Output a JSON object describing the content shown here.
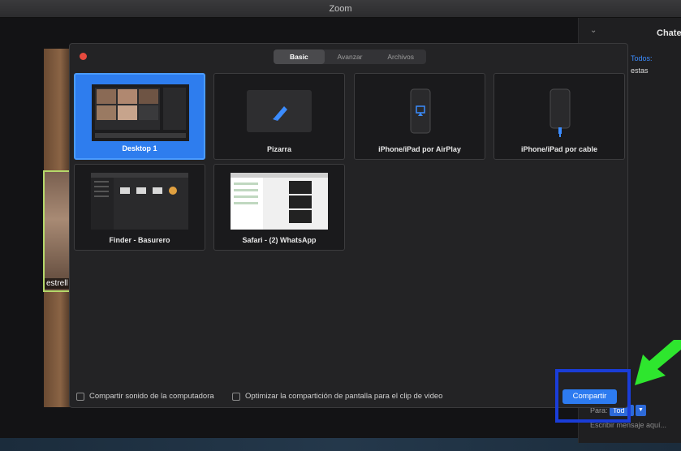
{
  "window": {
    "title": "Zoom"
  },
  "chat": {
    "title": "Chatea",
    "to_all": "Todos:",
    "message": "estas",
    "para_label": "Para:",
    "recipient": "Tod",
    "input_placeholder": "Escribir mensaje aquí..."
  },
  "participant": {
    "name": "estrell"
  },
  "dialog": {
    "tabs": [
      {
        "label": "Basic",
        "active": true
      },
      {
        "label": "Avanzar",
        "active": false
      },
      {
        "label": "Archivos",
        "active": false
      }
    ],
    "tiles": [
      {
        "label": "Desktop 1",
        "icon": "desktop-thumbnail",
        "selected": true
      },
      {
        "label": "Pizarra",
        "icon": "whiteboard-pencil-icon",
        "selected": false
      },
      {
        "label": "iPhone/iPad por AirPlay",
        "icon": "airplay-phone-icon",
        "selected": false
      },
      {
        "label": "iPhone/iPad por cable",
        "icon": "cable-phone-icon",
        "selected": false
      },
      {
        "label": "Finder - Basurero",
        "icon": "finder-window-thumbnail",
        "selected": false
      },
      {
        "label": "Safari - (2) WhatsApp",
        "icon": "safari-window-thumbnail",
        "selected": false
      }
    ],
    "options": {
      "share_sound": "Compartir sonido de la computadora",
      "optimize_video": "Optimizar la compartición de pantalla para el clip de video"
    },
    "share_button": "Compartir"
  },
  "colors": {
    "accent": "#2d7bf0",
    "highlight": "#1a3dd8",
    "arrow": "#2ee62e",
    "close": "#e64a3e"
  }
}
